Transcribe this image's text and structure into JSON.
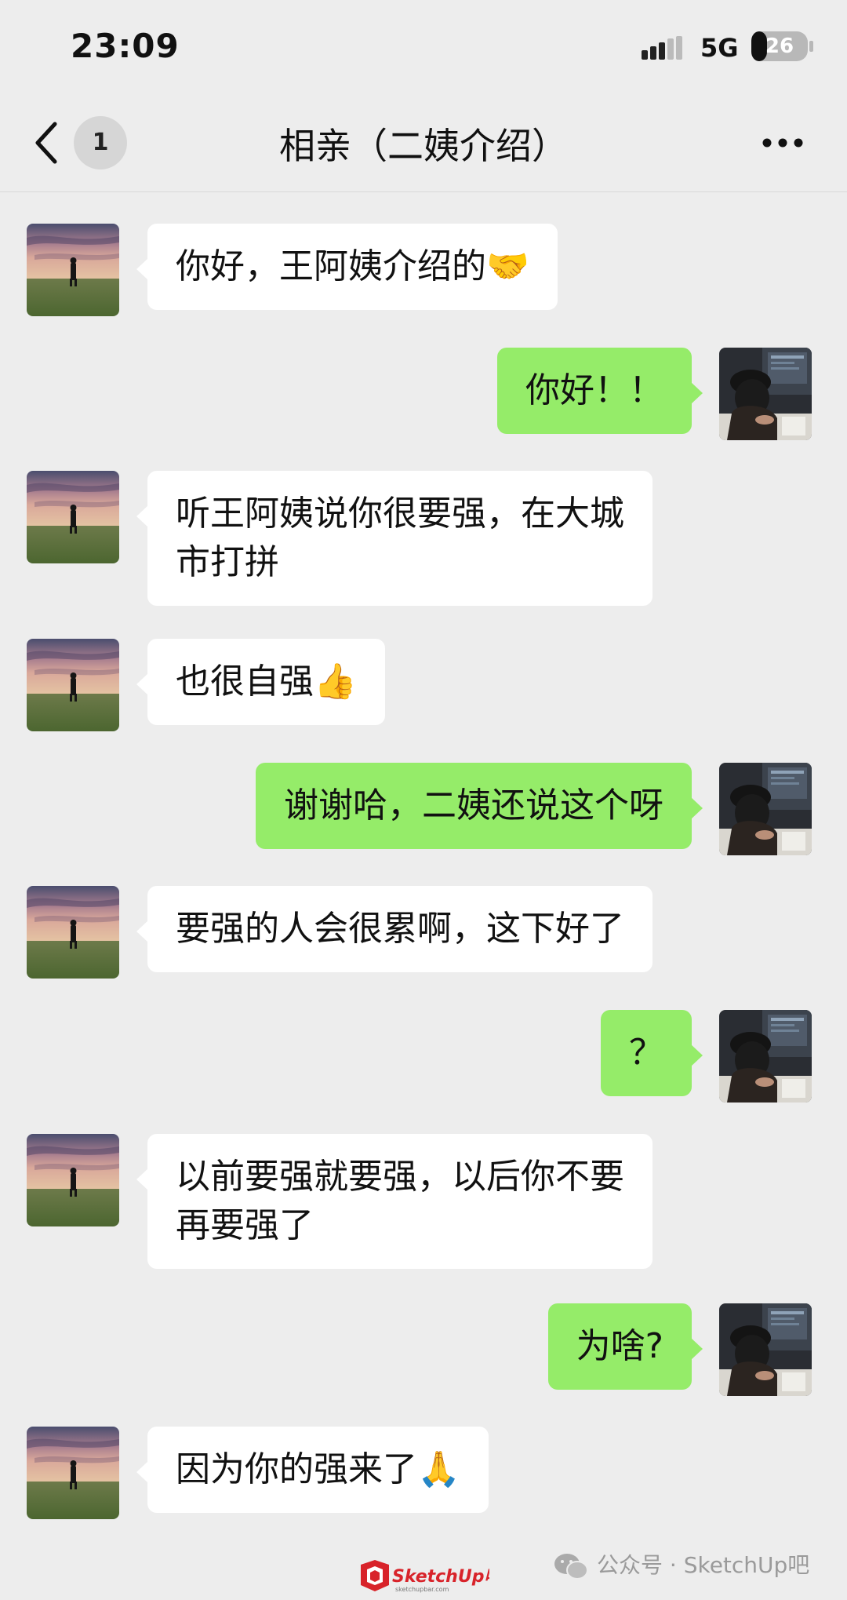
{
  "status_bar": {
    "time": "23:09",
    "network": "5G",
    "battery": "26"
  },
  "nav": {
    "unread_count": "1",
    "title": "相亲（二姨介绍）"
  },
  "messages": [
    {
      "side": "left",
      "text": "你好，王阿姨介绍的",
      "emoji": "🤝"
    },
    {
      "side": "right",
      "text": "你好！！",
      "emoji": ""
    },
    {
      "side": "left",
      "text": "听王阿姨说你很要强，在大城\n市打拼",
      "emoji": ""
    },
    {
      "side": "left",
      "text": "也很自强",
      "emoji": "👍"
    },
    {
      "side": "right",
      "text": "谢谢哈，二姨还说这个呀",
      "emoji": ""
    },
    {
      "side": "left",
      "text": "要强的人会很累啊，这下好了",
      "emoji": ""
    },
    {
      "side": "right",
      "text": "？",
      "emoji": ""
    },
    {
      "side": "left",
      "text": "以前要强就要强，以后你不要\n再要强了",
      "emoji": ""
    },
    {
      "side": "right",
      "text": "为啥?",
      "emoji": ""
    },
    {
      "side": "left",
      "text": "因为你的强来了",
      "emoji": "🙏"
    }
  ],
  "watermark": {
    "text": "公众号 · SketchUp吧",
    "logo_text": "SketchUp吧",
    "logo_sub": "sketchupbar.com"
  },
  "colors": {
    "background": "#ededed",
    "bubble_self": "#95ec69",
    "bubble_other": "#ffffff"
  }
}
